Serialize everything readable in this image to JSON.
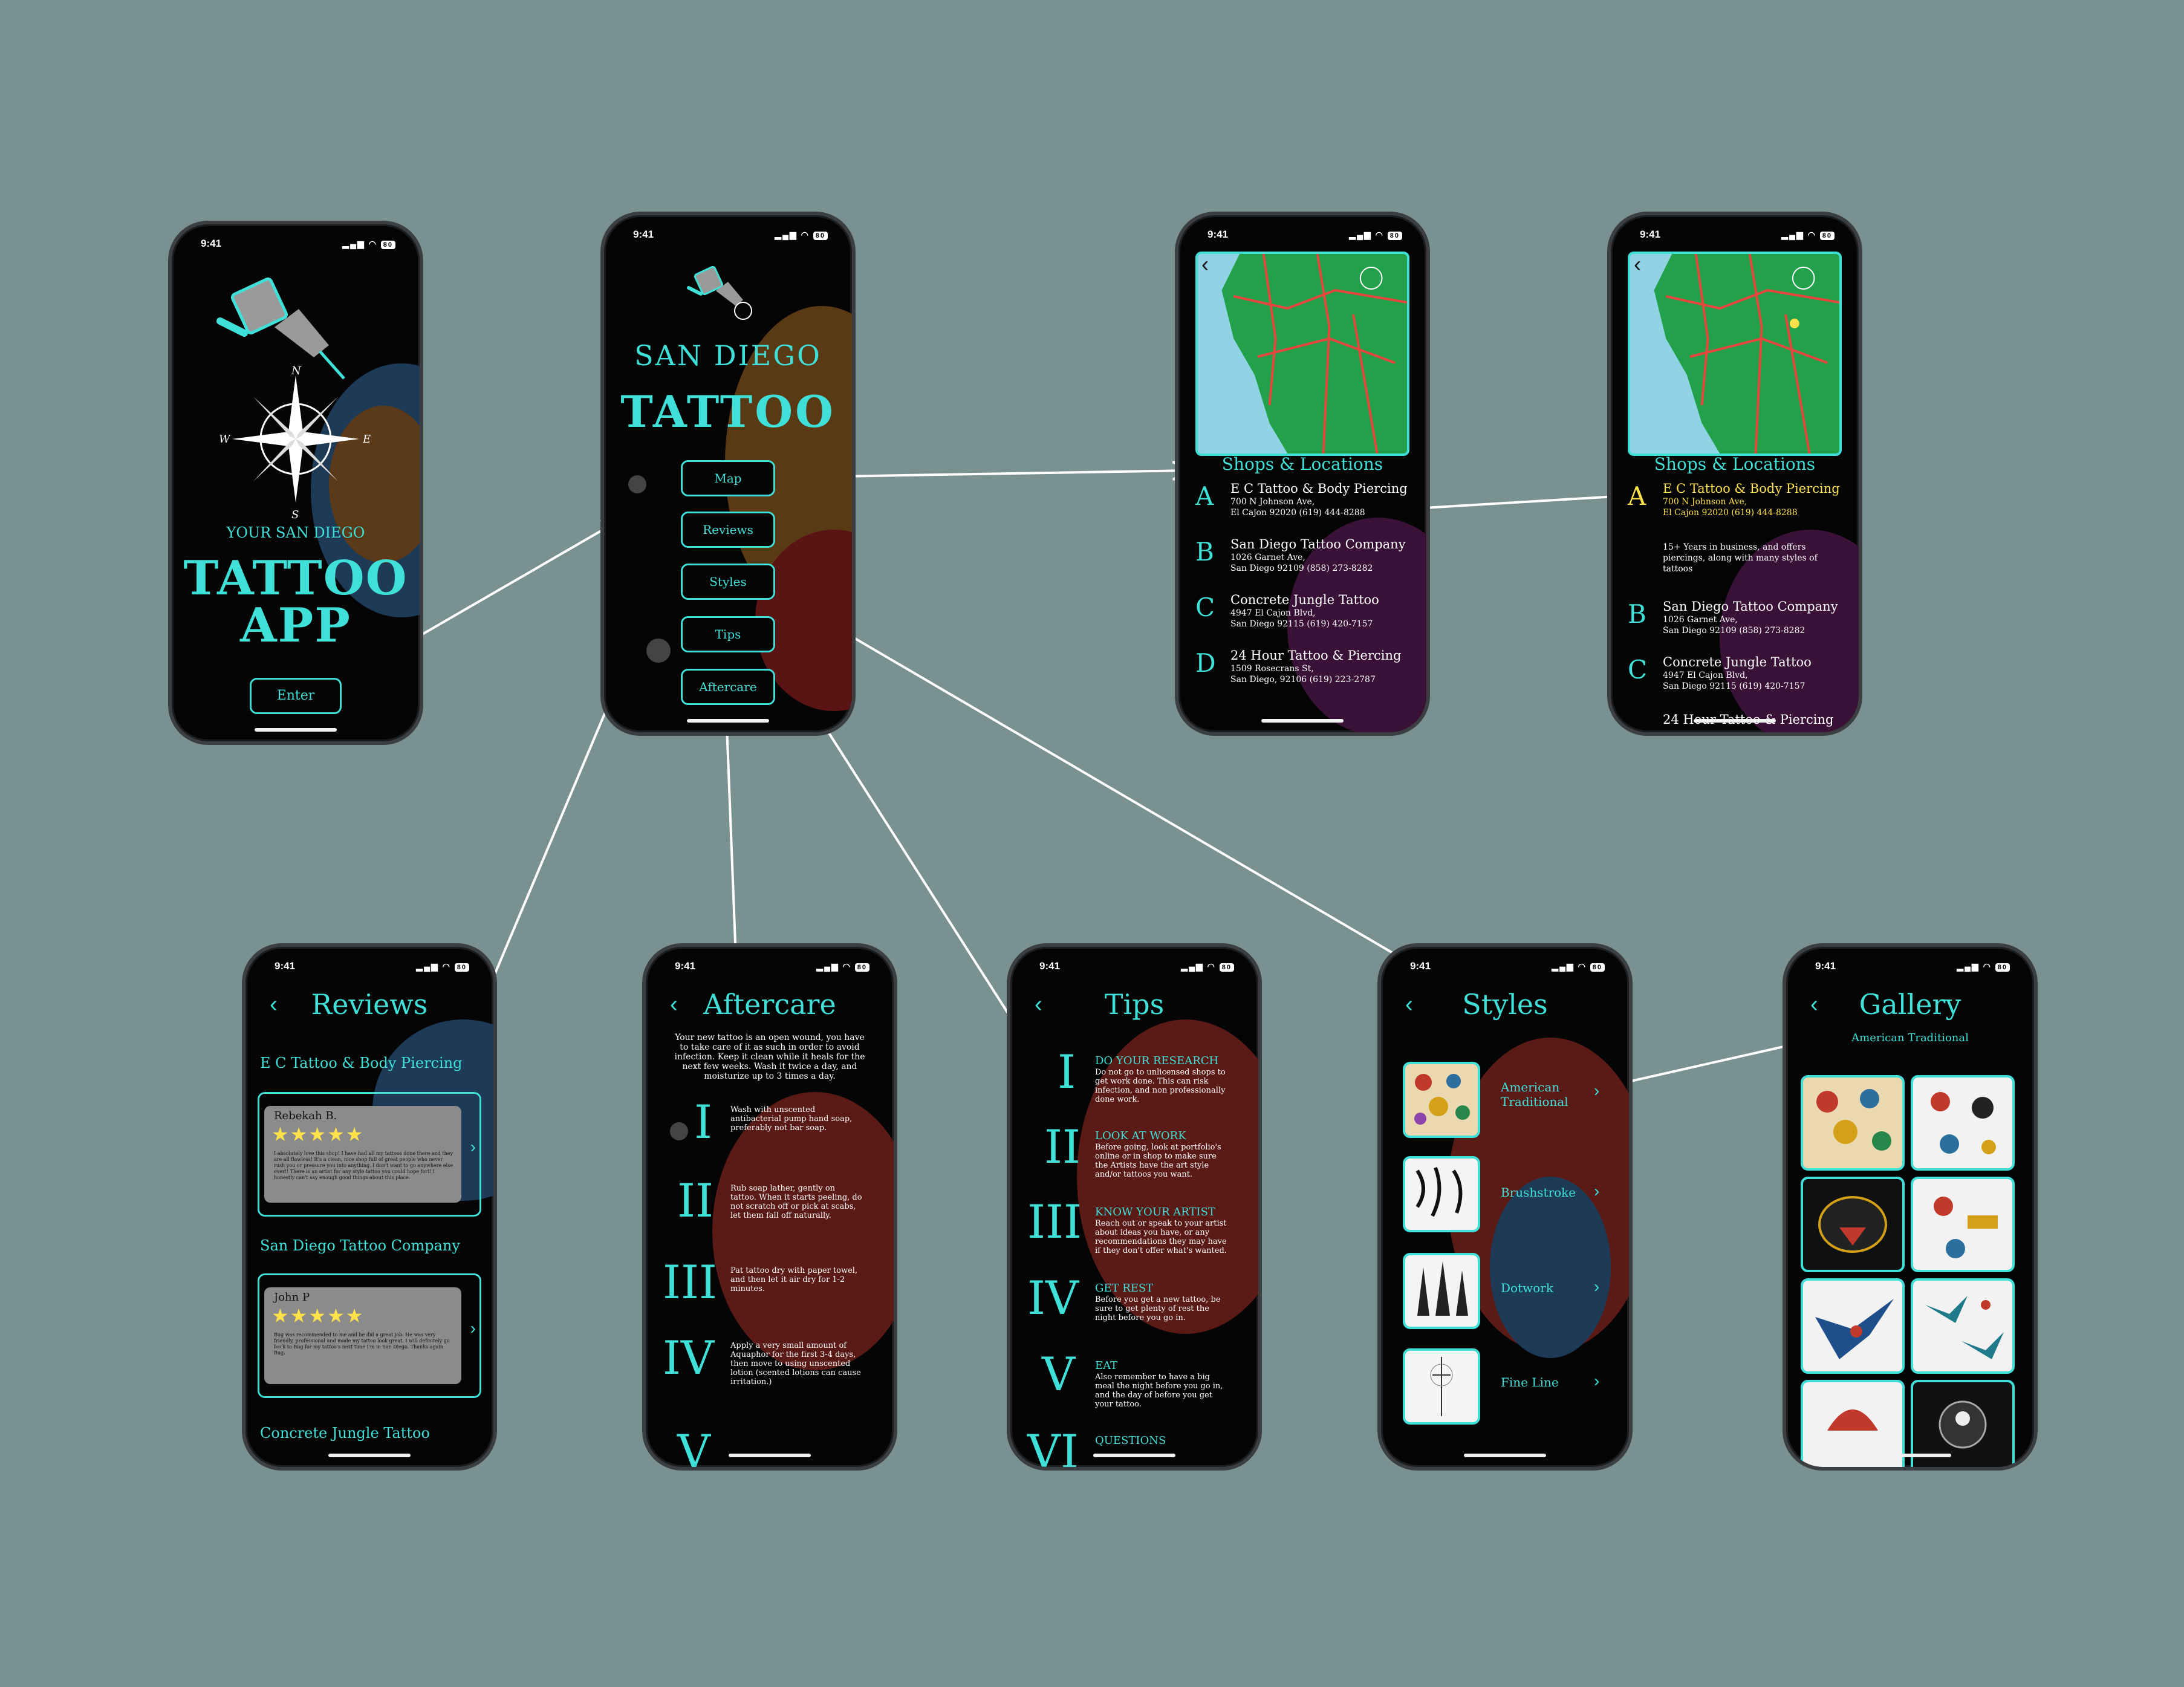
{
  "status": {
    "time": "9:41",
    "battery": "80"
  },
  "splash": {
    "subtitle": "YOUR SAN DIEGO",
    "title_line1": "TATTOO",
    "title_line2": "APP",
    "compass_n": "N",
    "compass_s": "S",
    "compass_e": "E",
    "compass_w": "W",
    "enter_label": "Enter"
  },
  "home": {
    "title_line1": "SAN DIEGO",
    "title_line2": "TATTOO",
    "buttons": [
      "Map",
      "Reviews",
      "Styles",
      "Tips",
      "Aftercare"
    ]
  },
  "map": {
    "heading": "Shops & Locations",
    "shops": [
      {
        "letter": "A",
        "name": "E C Tattoo & Body Piercing",
        "address": "700 N Johnson Ave,",
        "city": "El Cajon 92020 (619) 444-8288"
      },
      {
        "letter": "B",
        "name": "San Diego Tattoo Company",
        "address": "1026 Garnet Ave,",
        "city": "San Diego 92109 (858) 273-8282"
      },
      {
        "letter": "C",
        "name": "Concrete Jungle Tattoo",
        "address": "4947 El Cajon Blvd,",
        "city": "San Diego 92115 (619) 420-7157"
      },
      {
        "letter": "D",
        "name": "24 Hour Tattoo & Piercing",
        "address": "1509 Rosecrans St,",
        "city": "San Diego, 92106 (619) 223-2787"
      }
    ],
    "detail_text": "15+ Years in business, and offers piercings, along with many styles of tattoos",
    "partial_next": "24 Hour Tattoo & Piercing"
  },
  "reviews": {
    "title": "Reviews",
    "shop1": "E C Tattoo & Body Piercing",
    "review1_name": "Rebekah B.",
    "review1_text": "I absolutely love this shop! I have had all my tattoos done there and they are all flawless! It's a clean, nice shop full of great people who never rush you or pressure you into anything. I don't want to go anywhere else ever!! There is an artist for any style tattoo you could hope for!! I honestly can't say enough good things about this place.",
    "shop2": "San Diego Tattoo Company",
    "review2_name": "John P",
    "review2_text": "Bug was recommended to me and he did a great job. He was very friendly, professional and made my tattoo look great. I will definitely go back to Bug for my tattoo's next time I'm in San Diego. Thanks again Bug.",
    "shop3": "Concrete Jungle  Tattoo",
    "stars": "★★★★★",
    "chevron": "›"
  },
  "aftercare": {
    "title": "Aftercare",
    "intro": "Your new tattoo is an open wound, you have to take care of it as such in order to avoid infection. Keep it clean while it heals for the next few weeks. Wash it twice a day, and moisturize up to 3 times a day.",
    "steps": [
      {
        "num": "I",
        "text": "Wash with unscented antibacterial pump hand soap, preferably not bar soap."
      },
      {
        "num": "II",
        "text": "Rub soap lather, gently on tattoo. When it starts peeling, do not scratch off or pick at scabs, let them fall off naturally."
      },
      {
        "num": "III",
        "text": "Pat tattoo dry with paper towel, and then let it air dry for 1-2 minutes."
      },
      {
        "num": "IV",
        "text": "Apply a very small amount of Aquaphor for the first 3-4 days, then move to using unscented lotion (scented lotions can cause irritation.)"
      },
      {
        "num": "V",
        "text": ""
      }
    ]
  },
  "tips": {
    "title": "Tips",
    "items": [
      {
        "num": "I",
        "head": "DO YOUR RESEARCH",
        "text": "Do not go to unlicensed shops to get work done. This can risk infection, and non professionally done work."
      },
      {
        "num": "II",
        "head": "LOOK AT WORK",
        "text": "Before going, look at portfolio's online or in shop to make sure the Artists have the art style and/or tattoos you want."
      },
      {
        "num": "III",
        "head": "KNOW YOUR ARTIST",
        "text": "Reach out or speak to your artist about ideas you have, or any recommendations they may have if they don't offer what's wanted."
      },
      {
        "num": "IV",
        "head": "GET REST",
        "text": "Before you get a new tattoo, be sure to get plenty of rest the night before you go in."
      },
      {
        "num": "V",
        "head": "EAT",
        "text": "Also remember to have a big meal the night before you go in, and the day of before you get your tattoo."
      },
      {
        "num": "VI",
        "head": "QUESTIONS",
        "text": ""
      }
    ]
  },
  "styles": {
    "title": "Styles",
    "items": [
      "American Traditional",
      "Brushstroke",
      "Dotwork",
      "Fine Line"
    ],
    "chevron": "›"
  },
  "gallery": {
    "title": "Gallery",
    "subtitle": "American Traditional"
  },
  "back_glyph": "‹",
  "colors": {
    "accent": "#3fe0d8",
    "highlight": "#ffe14a",
    "background": "#7a9191",
    "screen": "#050505"
  }
}
